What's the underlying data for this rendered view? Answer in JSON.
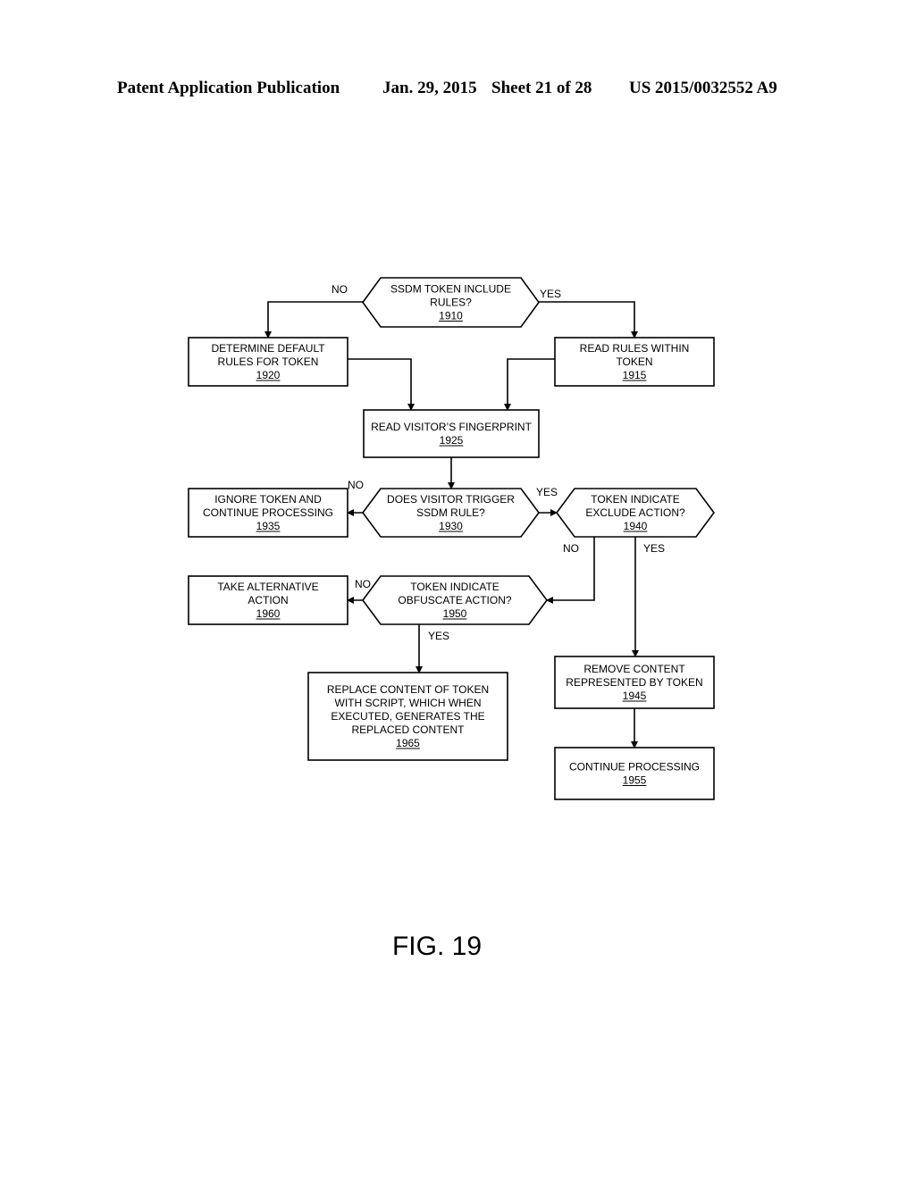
{
  "header": {
    "publication": "Patent Application Publication",
    "date": "Jan. 29, 2015",
    "sheet": "Sheet 21 of 28",
    "number": "US 2015/0032552 A9"
  },
  "figure_label": "FIG. 19",
  "nodes": {
    "n1910": {
      "type": "decision",
      "lines": [
        "SSDM TOKEN INCLUDE",
        "RULES?"
      ],
      "ref": "1910"
    },
    "n1920": {
      "type": "process",
      "lines": [
        "DETERMINE DEFAULT",
        "RULES FOR TOKEN"
      ],
      "ref": "1920"
    },
    "n1915": {
      "type": "process",
      "lines": [
        "READ RULES WITHIN",
        "TOKEN"
      ],
      "ref": "1915"
    },
    "n1925": {
      "type": "process",
      "lines": [
        "READ VISITOR’S FINGERPRINT"
      ],
      "ref": "1925"
    },
    "n1935": {
      "type": "process",
      "lines": [
        "IGNORE TOKEN AND",
        "CONTINUE PROCESSING"
      ],
      "ref": "1935"
    },
    "n1930": {
      "type": "decision",
      "lines": [
        "DOES VISITOR TRIGGER",
        "SSDM RULE?"
      ],
      "ref": "1930"
    },
    "n1940": {
      "type": "decision",
      "lines": [
        "TOKEN INDICATE",
        "EXCLUDE ACTION?"
      ],
      "ref": "1940"
    },
    "n1960": {
      "type": "process",
      "lines": [
        "TAKE ALTERNATIVE",
        "ACTION"
      ],
      "ref": "1960"
    },
    "n1950": {
      "type": "decision",
      "lines": [
        "TOKEN INDICATE",
        "OBFUSCATE ACTION?"
      ],
      "ref": "1950"
    },
    "n1965": {
      "type": "process",
      "lines": [
        "REPLACE CONTENT OF TOKEN",
        "WITH SCRIPT, WHICH WHEN",
        "EXECUTED, GENERATES THE",
        "REPLACED CONTENT"
      ],
      "ref": "1965"
    },
    "n1945": {
      "type": "process",
      "lines": [
        "REMOVE CONTENT",
        "REPRESENTED BY TOKEN"
      ],
      "ref": "1945"
    },
    "n1955": {
      "type": "process",
      "lines": [
        "CONTINUE PROCESSING"
      ],
      "ref": "1955"
    }
  },
  "edges": [
    {
      "from": "1910",
      "to": "1920",
      "label": "NO"
    },
    {
      "from": "1910",
      "to": "1915",
      "label": "YES"
    },
    {
      "from": "1920",
      "to": "1925",
      "label": ""
    },
    {
      "from": "1915",
      "to": "1925",
      "label": ""
    },
    {
      "from": "1925",
      "to": "1930",
      "label": ""
    },
    {
      "from": "1930",
      "to": "1935",
      "label": "NO"
    },
    {
      "from": "1930",
      "to": "1940",
      "label": "YES"
    },
    {
      "from": "1940",
      "to": "1950",
      "label": "NO"
    },
    {
      "from": "1940",
      "to": "1945",
      "label": "YES"
    },
    {
      "from": "1950",
      "to": "1960",
      "label": "NO"
    },
    {
      "from": "1950",
      "to": "1965",
      "label": "YES"
    },
    {
      "from": "1945",
      "to": "1955",
      "label": ""
    }
  ]
}
